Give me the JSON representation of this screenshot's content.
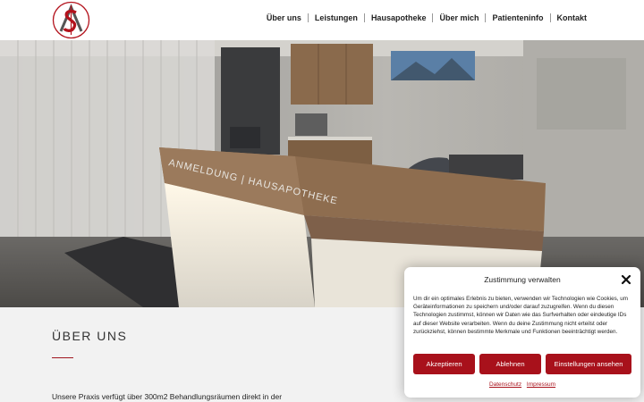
{
  "nav": {
    "items": [
      {
        "label": "Über uns"
      },
      {
        "label": "Leistungen"
      },
      {
        "label": "Hausapotheke"
      },
      {
        "label": "Über mich"
      },
      {
        "label": "Patienteninfo"
      },
      {
        "label": "Kontakt"
      }
    ]
  },
  "hero": {
    "counter_sign": "ANMELDUNG | HAUSAPOTHEKE"
  },
  "about": {
    "title": "ÜBER UNS",
    "text": "Unsere Praxis verfügt über 300m2 Behandlungsräumen direkt in der"
  },
  "cookie": {
    "title": "Zustimmung verwalten",
    "text": "Um dir ein optimales Erlebnis zu bieten, verwenden wir Technologien wie Cookies, um Geräteinformationen zu speichern und/oder darauf zuzugreifen. Wenn du diesen Technologien zustimmst, können wir Daten wie das Surfverhalten oder eindeutige IDs auf dieser Website verarbeiten. Wenn du deine Zustimmung nicht erteilst oder zurückziehst, können bestimmte Merkmale und Funktionen beeinträchtigt werden.",
    "accept_label": "Akzeptieren",
    "deny_label": "Ablehnen",
    "settings_label": "Einstellungen ansehen",
    "privacy_label": "Datenschutz",
    "imprint_label": "Impressum"
  },
  "colors": {
    "accent": "#a8111b",
    "section_bg": "#f2f2f2"
  }
}
